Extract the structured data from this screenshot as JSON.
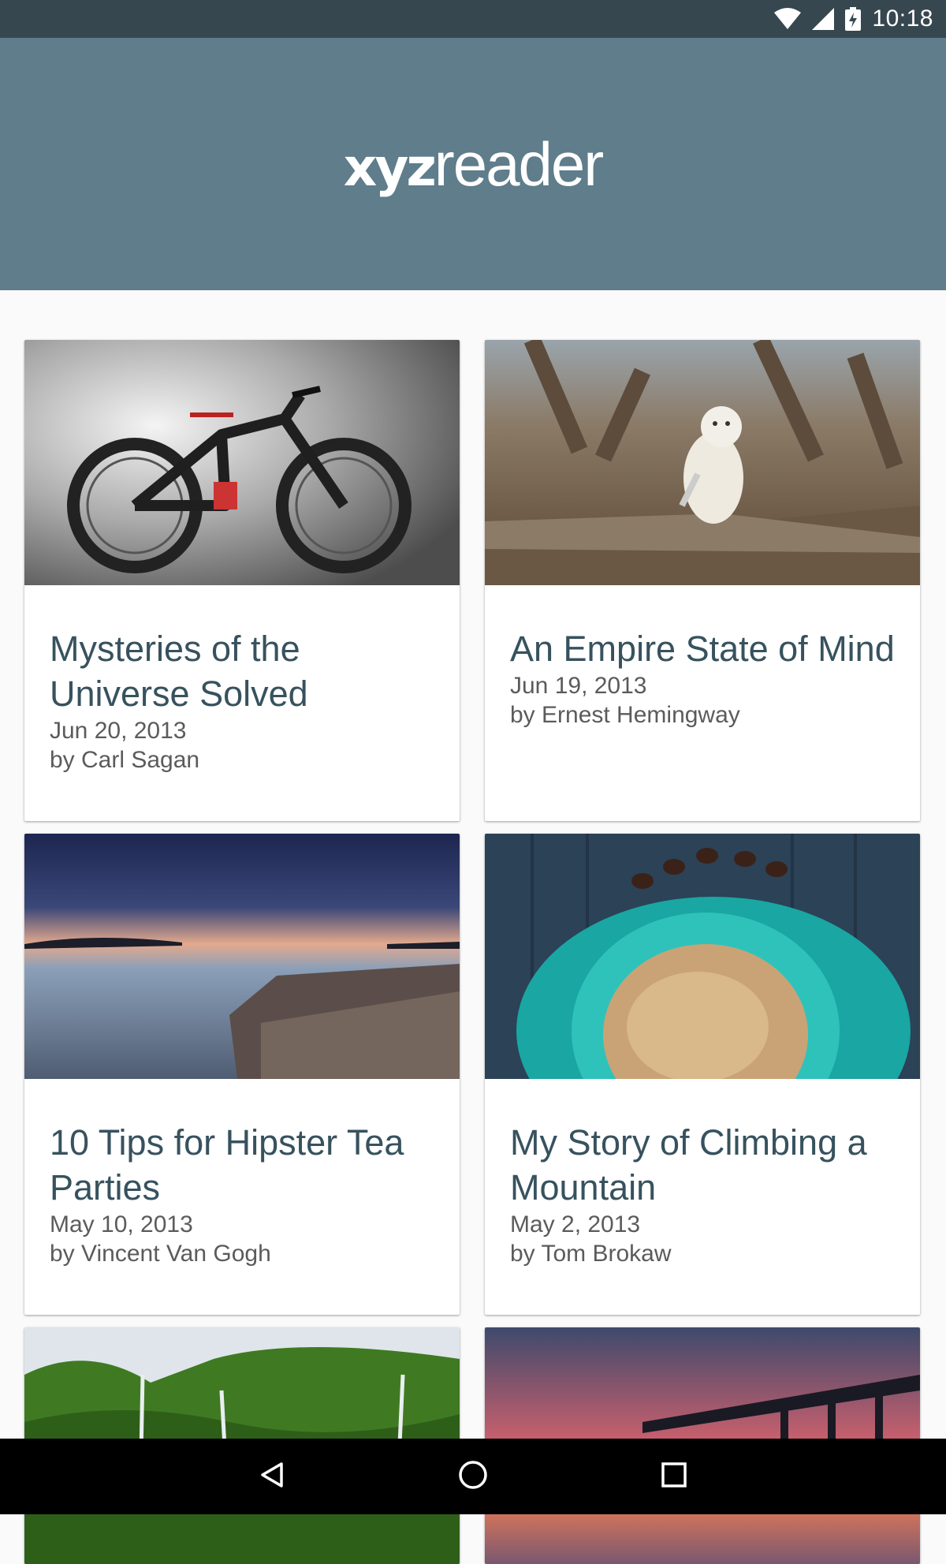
{
  "status_bar": {
    "time": "10:18",
    "icons": [
      "wifi-icon",
      "cell-signal-icon",
      "battery-charging-icon"
    ]
  },
  "header": {
    "logo_bold": "xyz",
    "logo_light": "reader",
    "background": "#5f7d8b"
  },
  "articles": [
    {
      "title": "Mysteries of the Universe Solved",
      "date": "Jun 20, 2013",
      "author": "by Carl Sagan",
      "image": "bicycle"
    },
    {
      "title": "An Empire State of Mind",
      "date": "Jun 19, 2013",
      "author": "by Ernest Hemingway",
      "image": "snowy-owl"
    },
    {
      "title": "10 Tips for Hipster Tea Parties",
      "date": "May 10, 2013",
      "author": "by Vincent Van Gogh",
      "image": "seascape"
    },
    {
      "title": "My Story of Climbing a Mountain",
      "date": "May 2, 2013",
      "author": "by Tom Brokaw",
      "image": "coffee-cup"
    },
    {
      "title": "",
      "date": "",
      "author": "",
      "image": "green-cliffs"
    },
    {
      "title": "",
      "date": "",
      "author": "",
      "image": "pier-sunset"
    }
  ],
  "nav_bar": {
    "buttons": [
      "back-icon",
      "home-icon",
      "recents-icon"
    ]
  },
  "colors": {
    "status_bar": "#37474f",
    "title_text": "#37525e",
    "meta_text": "#5b5b5b"
  }
}
